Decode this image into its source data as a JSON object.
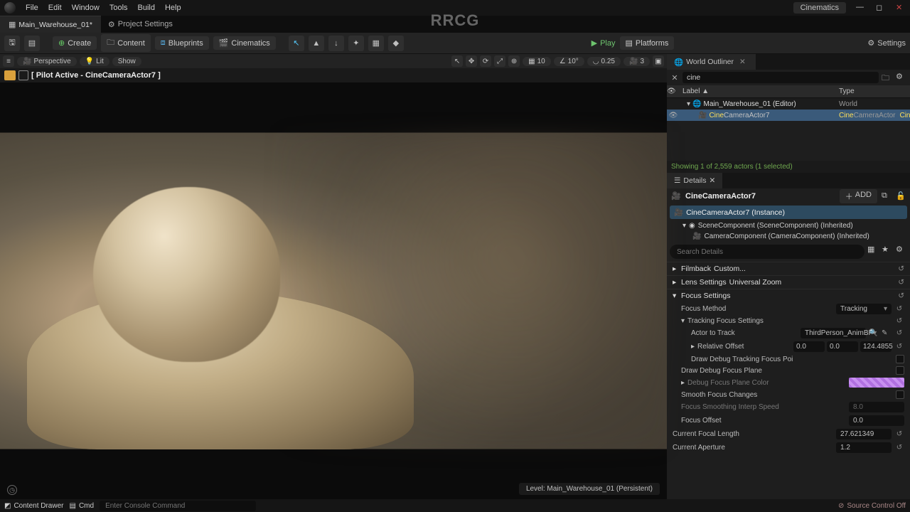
{
  "menu": {
    "items": [
      "File",
      "Edit",
      "Window",
      "Tools",
      "Build",
      "Help"
    ],
    "cinematics": "Cinematics"
  },
  "tabs": {
    "level": "Main_Warehouse_01*",
    "project": "Project Settings"
  },
  "toolbar": {
    "save_tip": "Save",
    "modes_tip": "Modes",
    "create": "Create",
    "content": "Content",
    "blueprints": "Blueprints",
    "cinematics": "Cinematics",
    "play": "Play",
    "platforms": "Platforms",
    "settings": "Settings"
  },
  "viewport": {
    "persp": "Perspective",
    "lit": "Lit",
    "show": "Show",
    "grid": "10",
    "rot": "10°",
    "scale": "0.25",
    "cam": "3",
    "pilot_label": "[ Pilot Active - CineCameraActor7 ]",
    "level_status": "Level: Main_Warehouse_01 (Persistent)"
  },
  "outliner": {
    "tab": "World Outliner",
    "search": "cine",
    "label_col": "Label ▲",
    "type_col": "Type",
    "root": "Main_Warehouse_01 (Editor)",
    "root_type": "World",
    "actor_pre": "Cine",
    "actor_mid": "CameraActor7",
    "type_pre": "Cine",
    "type_mid": "CameraActor",
    "class_pre": "Cine",
    "class_mid": "CameraActor",
    "summary": "Showing 1 of 2,559 actors (1 selected)"
  },
  "details": {
    "tab": "Details",
    "actor": "CineCameraActor7",
    "add": "ADD",
    "inst": "CineCameraActor7 (Instance)",
    "comp_scene": "SceneComponent (SceneComponent) (Inherited)",
    "comp_cam": "CameraComponent (CameraComponent) (Inherited)",
    "search_ph": "Search Details",
    "filmback": "Filmback",
    "filmback_val": "Custom...",
    "lens": "Lens Settings",
    "lens_val": "Universal Zoom",
    "focus": "Focus Settings",
    "focus_method": "Focus Method",
    "focus_method_val": "Tracking",
    "track_focus": "Tracking Focus Settings",
    "actor_track": "Actor to Track",
    "actor_track_val": "ThirdPerson_AnimBP",
    "rel_off": "Relative Offset",
    "off_x": "0.0",
    "off_y": "0.0",
    "off_z": "124.4855",
    "draw_track": "Draw Debug Tracking Focus Poi",
    "draw_plane": "Draw Debug Focus Plane",
    "plane_color": "Debug Focus Plane Color",
    "smooth": "Smooth Focus Changes",
    "smooth_speed": "Focus Smoothing Interp Speed",
    "smooth_speed_val": "8.0",
    "focus_offset": "Focus Offset",
    "focus_offset_val": "0.0",
    "focal": "Current Focal Length",
    "focal_val": "27.621349",
    "aperture": "Current Aperture",
    "aperture_val": "1.2"
  },
  "bottom": {
    "drawer": "Content Drawer",
    "cmd": "Cmd",
    "cmd_ph": "Enter Console Command",
    "source": "Source Control Off"
  },
  "watermark": "RRCG"
}
